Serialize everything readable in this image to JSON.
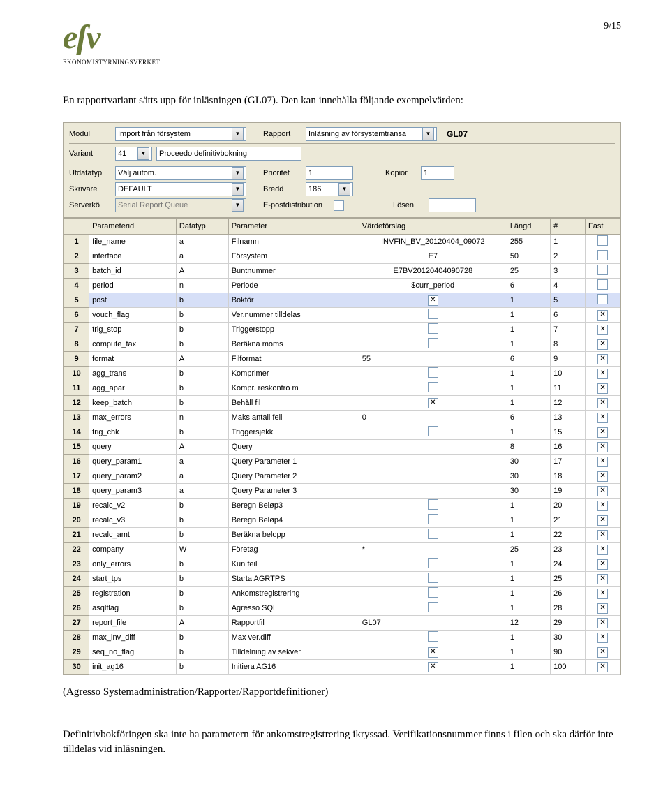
{
  "pageNumber": "9/15",
  "logoSub": "EKONOMISTYRNINGSVERKET",
  "intro1": "En rapportvariant sätts upp för inläsningen (GL07). Den kan innehålla följande exempelvärden:",
  "caption": "(Agresso Systemadministration/Rapporter/Rapportdefinitioner)",
  "outro": "Definitivbokföringen ska inte ha parametern för ankomstregistrering ikryssad. Verifikationsnummer finns i filen och ska därför inte tilldelas vid inläsningen.",
  "form": {
    "modulLabel": "Modul",
    "modulValue": "Import från försystem",
    "rapportLabel": "Rapport",
    "rapportValue": "Inläsning av försystemtransa",
    "rapCode": "GL07",
    "variantLabel": "Variant",
    "variantValue": "41",
    "variantText": "Proceedo definitivbokning",
    "utdatatypLabel": "Utdatatyp",
    "utdatatypValue": "Välj autom.",
    "prioritetLabel": "Prioritet",
    "prioritetValue": "1",
    "kopiorLabel": "Kopior",
    "kopiorValue": "1",
    "skrivareLabel": "Skrivare",
    "skrivareValue": "DEFAULT",
    "breddLabel": "Bredd",
    "breddValue": "186",
    "serverkoLabel": "Serverkö",
    "serverkoValue": "Serial Report Queue",
    "epostLabel": "E-postdistribution",
    "losenLabel": "Lösen"
  },
  "headers": {
    "rownum": "",
    "paramid": "Parameterid",
    "datatyp": "Datatyp",
    "parameter": "Parameter",
    "vardeforslag": "Värdeförslag",
    "langd": "Längd",
    "num": "#",
    "fast": "Fast"
  },
  "rows": [
    {
      "n": "1",
      "id": "file_name",
      "dt": "a",
      "p": "Filnamn",
      "v": "INVFIN_BV_20120404_09072",
      "l": "255",
      "num": "1",
      "chk": false,
      "fast": false
    },
    {
      "n": "2",
      "id": "interface",
      "dt": "a",
      "p": "Försystem",
      "v": "E7",
      "l": "50",
      "num": "2",
      "chk": false,
      "fast": false
    },
    {
      "n": "3",
      "id": "batch_id",
      "dt": "A",
      "p": "Buntnummer",
      "v": "E7BV20120404090728",
      "l": "25",
      "num": "3",
      "chk": false,
      "fast": false
    },
    {
      "n": "4",
      "id": "period",
      "dt": "n",
      "p": "Periode",
      "v": "$curr_period",
      "l": "6",
      "num": "4",
      "chk": false,
      "fast": false
    },
    {
      "n": "5",
      "id": "post",
      "dt": "b",
      "p": "Bokför",
      "v": "",
      "l": "1",
      "num": "5",
      "chk": true,
      "fast": false,
      "sel": true
    },
    {
      "n": "6",
      "id": "vouch_flag",
      "dt": "b",
      "p": "Ver.nummer tilldelas",
      "v": "",
      "l": "1",
      "num": "6",
      "chk": false,
      "fast": true
    },
    {
      "n": "7",
      "id": "trig_stop",
      "dt": "b",
      "p": "Triggerstopp",
      "v": "",
      "l": "1",
      "num": "7",
      "chk": false,
      "fast": true
    },
    {
      "n": "8",
      "id": "compute_tax",
      "dt": "b",
      "p": "Beräkna moms",
      "v": "",
      "l": "1",
      "num": "8",
      "chk": false,
      "fast": true
    },
    {
      "n": "9",
      "id": "format",
      "dt": "A",
      "p": "Filformat",
      "v": "55",
      "l": "6",
      "num": "9",
      "chk": null,
      "fast": true
    },
    {
      "n": "10",
      "id": "agg_trans",
      "dt": "b",
      "p": "Komprimer",
      "v": "",
      "l": "1",
      "num": "10",
      "chk": false,
      "fast": true
    },
    {
      "n": "11",
      "id": "agg_apar",
      "dt": "b",
      "p": "Kompr. reskontro m",
      "v": "",
      "l": "1",
      "num": "11",
      "chk": false,
      "fast": true
    },
    {
      "n": "12",
      "id": "keep_batch",
      "dt": "b",
      "p": "Behåll fil",
      "v": "",
      "l": "1",
      "num": "12",
      "chk": true,
      "fast": true
    },
    {
      "n": "13",
      "id": "max_errors",
      "dt": "n",
      "p": "Maks antall feil",
      "v": "0",
      "l": "6",
      "num": "13",
      "chk": null,
      "fast": true
    },
    {
      "n": "14",
      "id": "trig_chk",
      "dt": "b",
      "p": "Triggersjekk",
      "v": "",
      "l": "1",
      "num": "15",
      "chk": false,
      "fast": true
    },
    {
      "n": "15",
      "id": "query",
      "dt": "A",
      "p": "Query",
      "v": "",
      "l": "8",
      "num": "16",
      "chk": null,
      "fast": true
    },
    {
      "n": "16",
      "id": "query_param1",
      "dt": "a",
      "p": "Query Parameter 1",
      "v": "",
      "l": "30",
      "num": "17",
      "chk": null,
      "fast": true
    },
    {
      "n": "17",
      "id": "query_param2",
      "dt": "a",
      "p": "Query Parameter 2",
      "v": "",
      "l": "30",
      "num": "18",
      "chk": null,
      "fast": true
    },
    {
      "n": "18",
      "id": "query_param3",
      "dt": "a",
      "p": "Query Parameter 3",
      "v": "",
      "l": "30",
      "num": "19",
      "chk": null,
      "fast": true
    },
    {
      "n": "19",
      "id": "recalc_v2",
      "dt": "b",
      "p": "Beregn Beløp3",
      "v": "",
      "l": "1",
      "num": "20",
      "chk": false,
      "fast": true
    },
    {
      "n": "20",
      "id": "recalc_v3",
      "dt": "b",
      "p": "Beregn Beløp4",
      "v": "",
      "l": "1",
      "num": "21",
      "chk": false,
      "fast": true
    },
    {
      "n": "21",
      "id": "recalc_amt",
      "dt": "b",
      "p": "Beräkna belopp",
      "v": "",
      "l": "1",
      "num": "22",
      "chk": false,
      "fast": true
    },
    {
      "n": "22",
      "id": "company",
      "dt": "W",
      "p": "Företag",
      "v": "*",
      "l": "25",
      "num": "23",
      "chk": null,
      "fast": true
    },
    {
      "n": "23",
      "id": "only_errors",
      "dt": "b",
      "p": "Kun feil",
      "v": "",
      "l": "1",
      "num": "24",
      "chk": false,
      "fast": true
    },
    {
      "n": "24",
      "id": "start_tps",
      "dt": "b",
      "p": "Starta AGRTPS",
      "v": "",
      "l": "1",
      "num": "25",
      "chk": false,
      "fast": true
    },
    {
      "n": "25",
      "id": "registration",
      "dt": "b",
      "p": "Ankomstregistrering",
      "v": "",
      "l": "1",
      "num": "26",
      "chk": false,
      "fast": true
    },
    {
      "n": "26",
      "id": "asqlflag",
      "dt": "b",
      "p": "Agresso SQL",
      "v": "",
      "l": "1",
      "num": "28",
      "chk": false,
      "fast": true
    },
    {
      "n": "27",
      "id": "report_file",
      "dt": "A",
      "p": "Rapportfil",
      "v": "GL07",
      "l": "12",
      "num": "29",
      "chk": null,
      "fast": true
    },
    {
      "n": "28",
      "id": "max_inv_diff",
      "dt": "b",
      "p": "Max ver.diff",
      "v": "",
      "l": "1",
      "num": "30",
      "chk": false,
      "fast": true
    },
    {
      "n": "29",
      "id": "seq_no_flag",
      "dt": "b",
      "p": "Tilldelning av sekver",
      "v": "",
      "l": "1",
      "num": "90",
      "chk": true,
      "fast": true
    },
    {
      "n": "30",
      "id": "init_ag16",
      "dt": "b",
      "p": "Initiera AG16",
      "v": "",
      "l": "1",
      "num": "100",
      "chk": true,
      "fast": true
    }
  ]
}
